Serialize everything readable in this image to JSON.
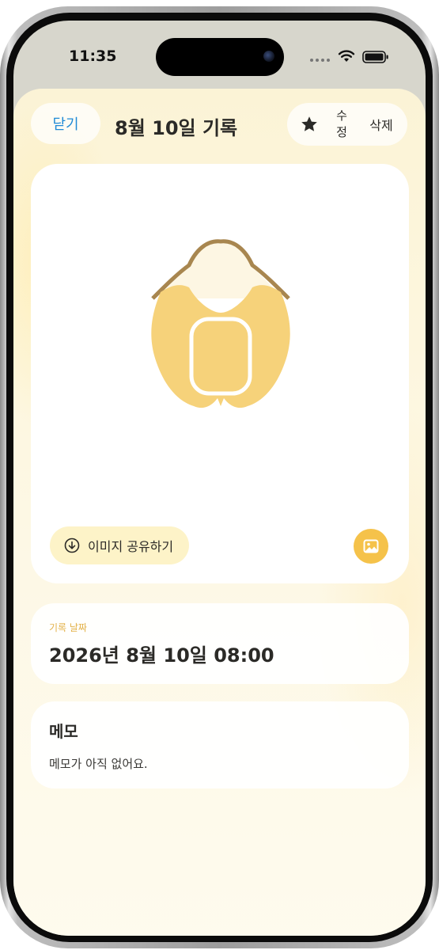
{
  "status_bar": {
    "time": "11:35"
  },
  "header": {
    "close_label": "닫기",
    "title": "8월 10일 기록",
    "favorite_icon": "star-icon",
    "edit_label": "수정",
    "delete_label": "삭제"
  },
  "image_card": {
    "illustration_icon": "onigiri-illustration",
    "share_label": "이미지 공유하기",
    "share_icon": "download-icon",
    "gallery_icon": "image-icon"
  },
  "date_card": {
    "label": "기록 날짜",
    "value": "2026년 8월 10일 08:00"
  },
  "memo_card": {
    "title": "메모",
    "body": "메모가 아직 없어요."
  },
  "colors": {
    "accent": "#f5c24a",
    "link": "#1f8ad6",
    "date_label": "#e3b24a",
    "sheet_background": "#fdf6dd",
    "text_primary": "#2b2a27"
  }
}
